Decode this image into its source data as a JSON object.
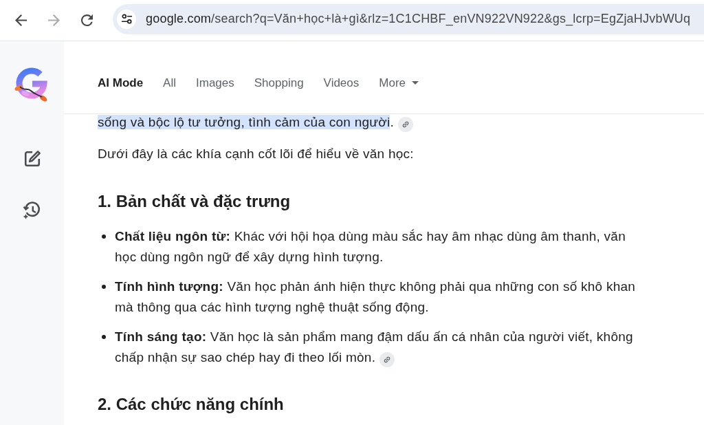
{
  "browser": {
    "nav_buttons": [
      {
        "kind": "back",
        "disabled": false
      },
      {
        "kind": "forward",
        "disabled": true
      },
      {
        "kind": "reload",
        "disabled": false
      }
    ],
    "address": {
      "host": "google.com",
      "path": "/search?q=Văn+học+là+gì&rlz=1C1CHBF_enVN922VN922&gs_lcrp=EgZjaHJvbWUq"
    }
  },
  "nav_tabs": [
    {
      "label": "AI Mode",
      "selected": true,
      "kind": "tab"
    },
    {
      "label": "All",
      "selected": false,
      "kind": "tab"
    },
    {
      "label": "Images",
      "selected": false,
      "kind": "tab"
    },
    {
      "label": "Shopping",
      "selected": false,
      "kind": "tab"
    },
    {
      "label": "Videos",
      "selected": false,
      "kind": "tab"
    },
    {
      "label": "More",
      "selected": false,
      "kind": "menu"
    }
  ],
  "answer": [
    {
      "kind": "paragraph",
      "segments": [
        {
          "text": "sống và bộc lộ tư tưởng, tình cảm của con người",
          "highlighted": true
        },
        {
          "text": ".",
          "highlighted": false
        }
      ],
      "source_link": true
    },
    {
      "kind": "paragraph",
      "segments": [
        {
          "text": "Dưới đây là các khía cạnh cốt lõi để hiểu về văn học:",
          "highlighted": false
        }
      ],
      "source_link": false
    },
    {
      "kind": "heading",
      "text": "1. Bản chất và đặc trưng"
    },
    {
      "kind": "bullets",
      "items": [
        {
          "text": "**Chất liệu ngôn từ:** Khác với hội họa dùng màu sắc hay âm nhạc dùng âm thanh, văn học dùng ngôn ngữ để xây dựng hình tượng.",
          "source_link": false
        },
        {
          "text": "**Tính hình tượng:** Văn học phản ánh hiện thực không phải qua những con số khô khan mà thông qua các hình tượng nghệ thuật sống động.",
          "source_link": false
        },
        {
          "text": "**Tính sáng tạo:** Văn học là sản phẩm mang đậm dấu ấn cá nhân của người viết, không chấp nhận sự sao chép hay đi theo lối mòn.",
          "source_link": true
        }
      ]
    },
    {
      "kind": "heading",
      "text": "2. Các chức năng chính"
    }
  ]
}
